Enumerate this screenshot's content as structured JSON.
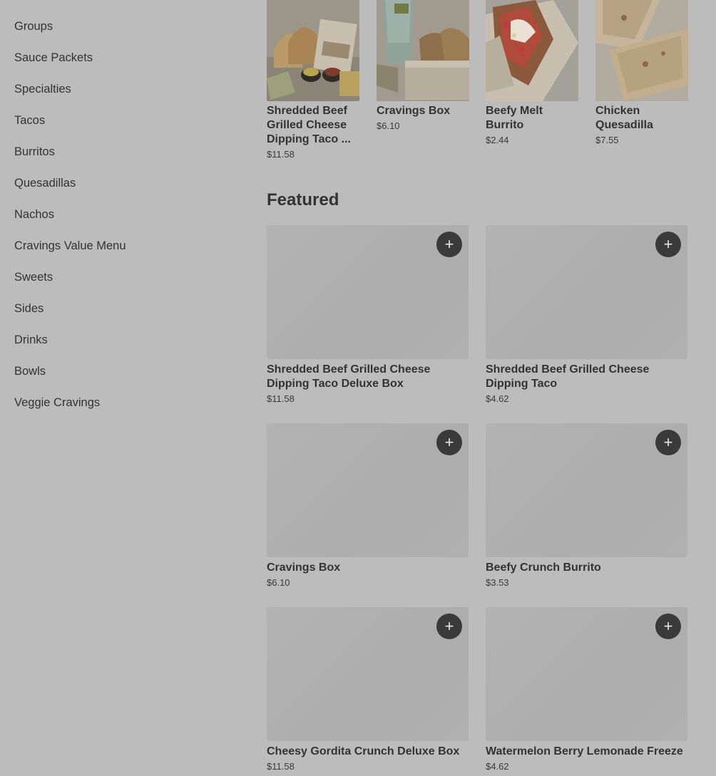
{
  "sidebar": {
    "items": [
      {
        "label": "Groups"
      },
      {
        "label": "Sauce Packets"
      },
      {
        "label": "Specialties"
      },
      {
        "label": "Tacos"
      },
      {
        "label": "Burritos"
      },
      {
        "label": "Quesadillas"
      },
      {
        "label": "Nachos"
      },
      {
        "label": "Cravings Value Menu"
      },
      {
        "label": "Sweets"
      },
      {
        "label": "Sides"
      },
      {
        "label": "Drinks"
      },
      {
        "label": "Bowls"
      },
      {
        "label": "Veggie Cravings"
      }
    ]
  },
  "carousel": {
    "items": [
      {
        "name": "Shredded Beef Grilled Cheese Dipping Taco ...",
        "price": "$11.58",
        "image": "deluxe-box-photo"
      },
      {
        "name": "Cravings Box",
        "price": "$6.10",
        "image": "cravings-box-photo"
      },
      {
        "name": "Beefy Melt Burrito",
        "price": "$2.44",
        "image": "burrito-photo"
      },
      {
        "name": "Chicken Quesadilla",
        "price": "$7.55",
        "image": "quesadilla-photo"
      }
    ]
  },
  "featured": {
    "title": "Featured",
    "add_label": "+",
    "items": [
      {
        "name": "Shredded Beef Grilled Cheese Dipping Taco Deluxe Box",
        "price": "$11.58"
      },
      {
        "name": "Shredded Beef Grilled Cheese Dipping Taco",
        "price": "$4.62"
      },
      {
        "name": "Cravings Box",
        "price": "$6.10"
      },
      {
        "name": "Beefy Crunch Burrito",
        "price": "$3.53"
      },
      {
        "name": "Cheesy Gordita Crunch Deluxe Box",
        "price": "$11.58"
      },
      {
        "name": "Watermelon Berry Lemonade Freeze",
        "price": "$4.62"
      }
    ]
  },
  "colors": {
    "overlay_bg": "#bcbcbc",
    "add_button": "#3a3a3a",
    "image_placeholder": "#b0b0b0"
  }
}
